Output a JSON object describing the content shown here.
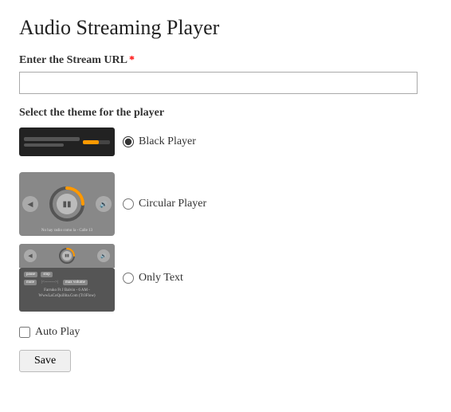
{
  "page": {
    "title": "Audio Streaming Player"
  },
  "form": {
    "stream_url_label": "Enter the Stream URL",
    "stream_url_placeholder": "",
    "required_star": "*",
    "theme_label": "Select the theme for the player",
    "themes": [
      {
        "id": "black",
        "label": "Black Player",
        "selected": true
      },
      {
        "id": "circular",
        "label": "Circular Player",
        "selected": false
      },
      {
        "id": "only-text",
        "label": "Only Text",
        "selected": false
      }
    ],
    "autoplay_label": "Auto Play",
    "save_label": "Save",
    "circular_no_radio_text": "No hay radio como la - Calle 13",
    "bottom_song_text": "Farruko Ft J Balvin - 6 AM - WwwLaCoQuillita.Com (Tr3Flow)"
  }
}
